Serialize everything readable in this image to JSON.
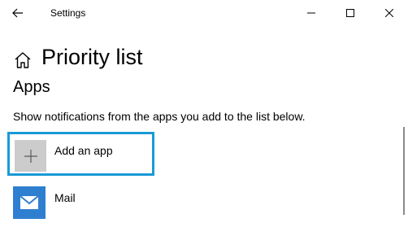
{
  "window": {
    "title": "Settings",
    "back_icon": "arrow-left-icon",
    "controls": {
      "minimize_icon": "minimize-icon",
      "maximize_icon": "maximize-icon",
      "close_icon": "close-icon"
    }
  },
  "header": {
    "icon": "home-icon",
    "title": "Priority list"
  },
  "section": {
    "title": "Apps",
    "description": "Show notifications from the apps you add to the list below."
  },
  "add_app": {
    "label": "Add an app",
    "icon": "plus-icon",
    "focus_color": "#1a9ad6",
    "icon_bg": "#cccccc"
  },
  "apps": [
    {
      "name": "Mail",
      "icon": "mail-icon",
      "icon_bg": "#2f7fd1"
    }
  ]
}
